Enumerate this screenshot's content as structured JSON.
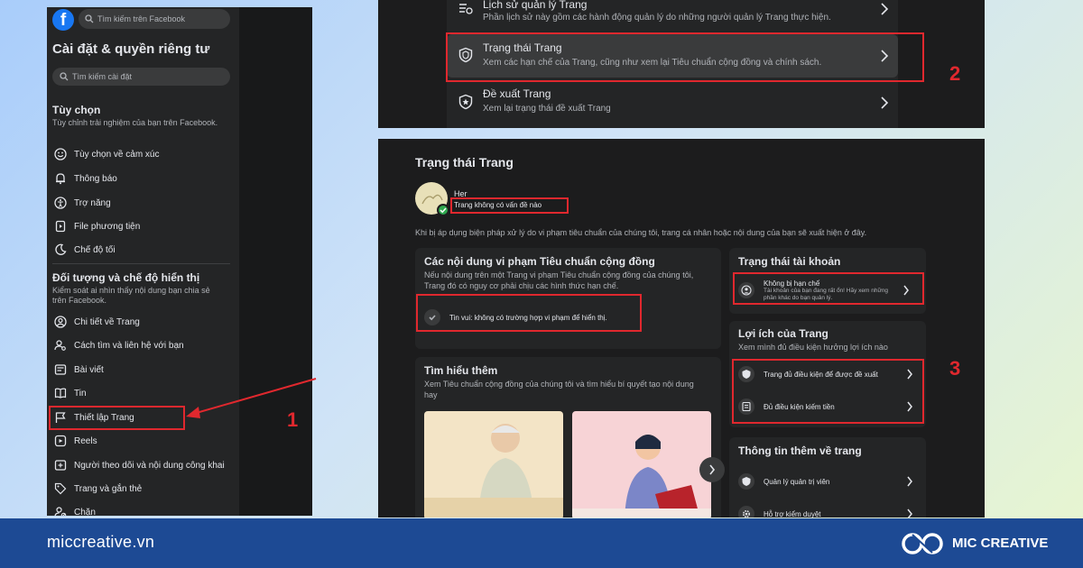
{
  "sidebar": {
    "logo_text": "f",
    "search_placeholder": "Tìm kiếm trên Facebook",
    "title": "Cài đặt & quyền riêng tư",
    "settings_search_placeholder": "Tìm kiếm cài đặt",
    "section1": {
      "title": "Tùy chọn",
      "desc": "Tùy chỉnh trải nghiệm của bạn trên Facebook.",
      "items": [
        {
          "label": "Tùy chọn về cảm xúc",
          "icon": "smiley-icon"
        },
        {
          "label": "Thông báo",
          "icon": "bell-icon"
        },
        {
          "label": "Trợ năng",
          "icon": "accessibility-icon"
        },
        {
          "label": "File phương tiện",
          "icon": "media-file-icon"
        },
        {
          "label": "Chế độ tối",
          "icon": "moon-icon"
        }
      ]
    },
    "section2": {
      "title": "Đối tượng và chế độ hiển thị",
      "desc": "Kiểm soát ai nhìn thấy nội dung bạn chia sẻ trên Facebook.",
      "items": [
        {
          "label": "Chi tiết về Trang",
          "icon": "user-circle-icon"
        },
        {
          "label": "Cách tìm và liên hệ với bạn",
          "icon": "user-search-icon"
        },
        {
          "label": "Bài viết",
          "icon": "posts-icon"
        },
        {
          "label": "Tin",
          "icon": "book-icon"
        },
        {
          "label": "Thiết lập Trang",
          "icon": "flag-icon"
        },
        {
          "label": "Reels",
          "icon": "reels-icon"
        },
        {
          "label": "Người theo dõi và nội dung công khai",
          "icon": "followers-icon"
        },
        {
          "label": "Trang và gắn thẻ",
          "icon": "tag-icon"
        },
        {
          "label": "Chặn",
          "icon": "block-user-icon"
        }
      ]
    }
  },
  "top_panel": {
    "rows": [
      {
        "title": "Lịch sử quản lý Trang",
        "desc": "Phần lịch sử này gồm các hành động quản lý do những người quản lý Trang thực hiện.",
        "icon": "history-icon"
      },
      {
        "title": "Trạng thái Trang",
        "desc": "Xem các hạn chế của Trang, cũng như xem lại Tiêu chuẩn cộng đồng và chính sách.",
        "icon": "shield-icon"
      },
      {
        "title": "Đề xuất Trang",
        "desc": "Xem lại trạng thái đề xuất Trang",
        "icon": "star-shield-icon"
      }
    ]
  },
  "status_panel": {
    "title": "Trạng thái Trang",
    "page_name": "Her",
    "status_text": "Trang không có vấn đề nào",
    "intro": "Khi bị áp dụng biện pháp xử lý do vi phạm tiêu chuẩn của chúng tôi, trang cá nhân hoặc nội dung của bạn sẽ xuất hiện ở đây.",
    "violations": {
      "title": "Các nội dung vi phạm Tiêu chuẩn cộng đồng",
      "desc": "Nếu nội dung trên một Trang vi phạm Tiêu chuẩn cộng đồng của chúng tôi, Trang đó có nguy cơ phải chịu các hình thức hạn chế.",
      "good_news": "Tin vui: không có trường hợp vi phạm để hiển thị."
    },
    "learn_more": {
      "title": "Tìm hiểu thêm",
      "desc": "Xem Tiêu chuẩn cộng đồng của chúng tôi và tìm hiểu bí quyết tạo nội dung hay"
    },
    "account_status": {
      "title": "Trạng thái tài khoản",
      "item_title": "Không bị hạn chế",
      "item_desc": "Tài khoản của bạn đang rất ổn! Hãy xem những phần khác do bạn quản lý."
    },
    "benefits": {
      "title": "Lợi ích của Trang",
      "desc": "Xem mình đủ điều kiện hưởng lợi ích nào",
      "items": [
        "Trang đủ điều kiện để được đề xuất",
        "Đủ điều kiện kiếm tiền"
      ]
    },
    "more_info": {
      "title": "Thông tin thêm về trang",
      "items": [
        "Quản lý quản trị viên",
        "Hỗ trợ kiểm duyệt"
      ]
    }
  },
  "markers": {
    "m1": "1",
    "m2": "2",
    "m3": "3"
  },
  "footer": {
    "url": "miccreative.vn",
    "brand": "MIC CREATIVE"
  },
  "colors": {
    "highlight": "#e0282e",
    "footer_bg": "#1d4a94",
    "facebook_blue": "#1877f2"
  }
}
